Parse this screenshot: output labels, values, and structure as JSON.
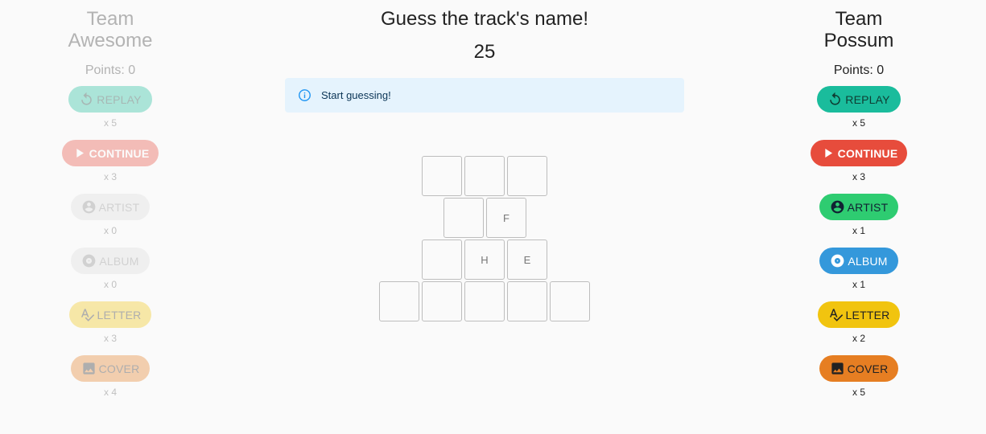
{
  "left_team": {
    "name_line1": "Team",
    "name_line2": "Awesome",
    "points": "Points: 0",
    "powerups": [
      {
        "label": "REPLAY",
        "count": "x 5"
      },
      {
        "label": "CONTINUE",
        "count": "x 3"
      },
      {
        "label": "ARTIST",
        "count": "x 0"
      },
      {
        "label": "ALBUM",
        "count": "x 0"
      },
      {
        "label": "LETTER",
        "count": "x 3"
      },
      {
        "label": "COVER",
        "count": "x 4"
      }
    ]
  },
  "right_team": {
    "name_line1": "Team",
    "name_line2": "Possum",
    "points": "Points: 0",
    "powerups": [
      {
        "label": "REPLAY",
        "count": "x 5"
      },
      {
        "label": "CONTINUE",
        "count": "x 3"
      },
      {
        "label": "ARTIST",
        "count": "x 1"
      },
      {
        "label": "ALBUM",
        "count": "x 1"
      },
      {
        "label": "LETTER",
        "count": "x 2"
      },
      {
        "label": "COVER",
        "count": "x 5"
      }
    ]
  },
  "game": {
    "title": "Guess the track's name!",
    "timer": "25",
    "alert": "Start guessing!",
    "letters": {
      "row2": [
        "",
        "F"
      ],
      "row3": [
        "",
        "H",
        "E"
      ],
      "row1": [
        "",
        "",
        ""
      ],
      "row4": [
        "",
        "",
        "",
        "",
        ""
      ]
    }
  },
  "colors": {
    "replay": "#1abc9c",
    "continue": "#e74c3c",
    "artist": "#2ecc71",
    "album": "#3498db",
    "letter": "#f1c40f",
    "cover": "#e67e22",
    "alert_bg": "#e5f3fd"
  },
  "icons": {
    "replay": "replay-icon",
    "continue": "play-icon",
    "artist": "account-circle-icon",
    "album": "disc-icon",
    "letter": "spellcheck-icon",
    "cover": "image-icon",
    "alert": "info-icon"
  }
}
